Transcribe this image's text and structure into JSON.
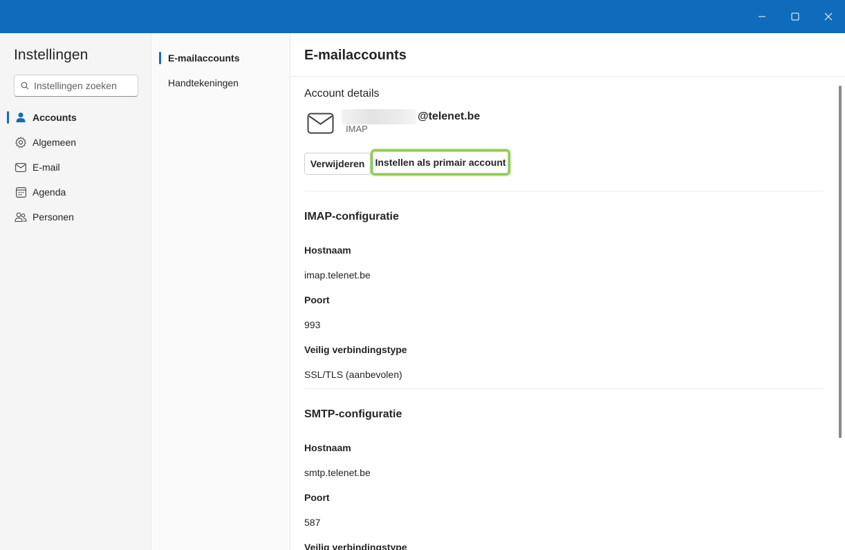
{
  "window": {
    "controls": [
      "minimize",
      "maximize",
      "close"
    ]
  },
  "nav": {
    "title": "Instellingen",
    "search_placeholder": "Instellingen zoeken",
    "items": [
      {
        "label": "Accounts",
        "icon": "person-icon",
        "active": true
      },
      {
        "label": "Algemeen",
        "icon": "gear-icon",
        "active": false
      },
      {
        "label": "E-mail",
        "icon": "mail-icon",
        "active": false
      },
      {
        "label": "Agenda",
        "icon": "calendar-icon",
        "active": false
      },
      {
        "label": "Personen",
        "icon": "people-icon",
        "active": false
      }
    ]
  },
  "subnav": {
    "items": [
      {
        "label": "E-mailaccounts",
        "active": true
      },
      {
        "label": "Handtekeningen",
        "active": false
      }
    ]
  },
  "content": {
    "title": "E-mailaccounts",
    "account": {
      "section_label": "Account details",
      "email_domain": "@telenet.be",
      "type": "IMAP",
      "remove_button": "Verwijderen",
      "primary_button": "Instellen als primair account"
    },
    "imap": {
      "title": "IMAP-configuratie",
      "host_label": "Hostnaam",
      "host_value": "imap.telenet.be",
      "port_label": "Poort",
      "port_value": "993",
      "security_label": "Veilig verbindingstype",
      "security_value": "SSL/TLS (aanbevolen)"
    },
    "smtp": {
      "title": "SMTP-configuratie",
      "host_label": "Hostnaam",
      "host_value": "smtp.telenet.be",
      "port_label": "Poort",
      "port_value": "587",
      "security_label": "Veilig verbindingstype"
    }
  },
  "colors": {
    "titlebar": "#0f6cbd",
    "accent": "#0f6cbd",
    "highlight": "#8dcd4e"
  }
}
